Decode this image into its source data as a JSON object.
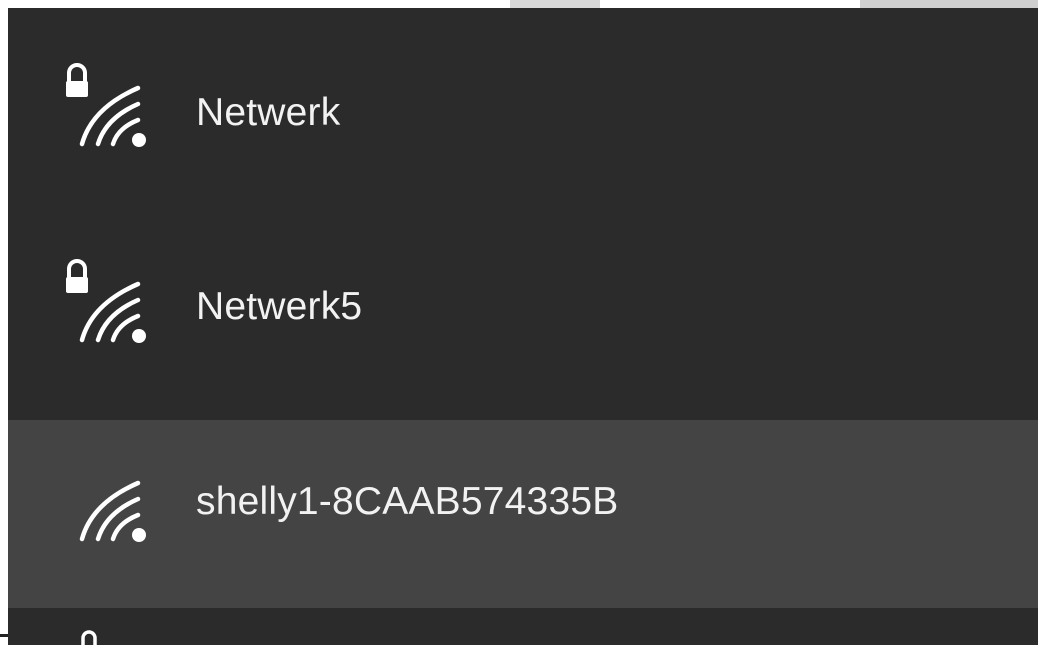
{
  "wifi_flyout": {
    "networks": [
      {
        "name": "Netwerk",
        "secured": true,
        "selected": false,
        "icon": "wifi-secured-icon"
      },
      {
        "name": "Netwerk5",
        "secured": true,
        "selected": false,
        "icon": "wifi-secured-icon"
      },
      {
        "name": "shelly1-8CAAB574335B",
        "secured": false,
        "selected": true,
        "icon": "wifi-open-icon"
      }
    ]
  },
  "colors": {
    "panel_bg": "#2b2b2b",
    "selected_bg": "#444444",
    "text": "#f2f2f2",
    "icon": "#ffffff"
  }
}
